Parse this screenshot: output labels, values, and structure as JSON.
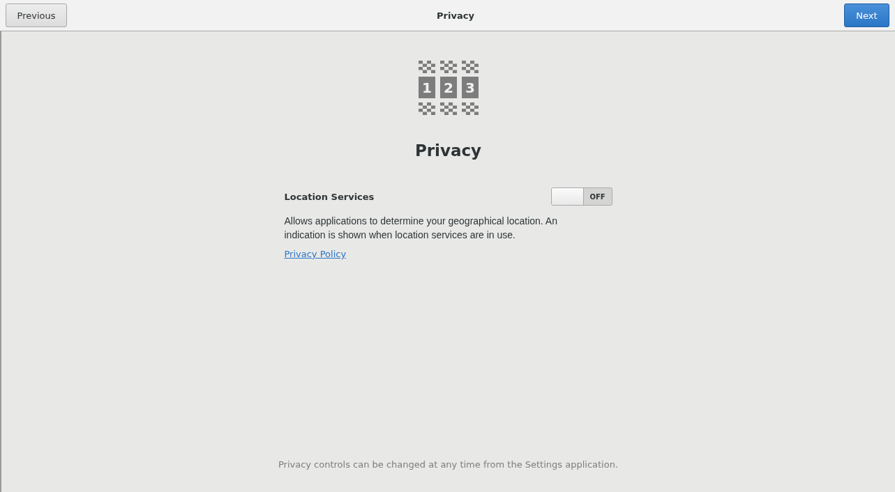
{
  "header_bar": {
    "previous_button": "Previous",
    "title": "Privacy",
    "next_button": "Next"
  },
  "page": {
    "icon_digits": [
      "1",
      "2",
      "3"
    ],
    "heading": "Privacy",
    "location_services": {
      "label": "Location Services",
      "on": false,
      "switch_label": "OFF",
      "description": "Allows applications to determine your geographical location. An indication is shown when location services are in use."
    },
    "link": "Privacy Policy",
    "footer": "Privacy controls can be changed at any time from the Settings application."
  }
}
